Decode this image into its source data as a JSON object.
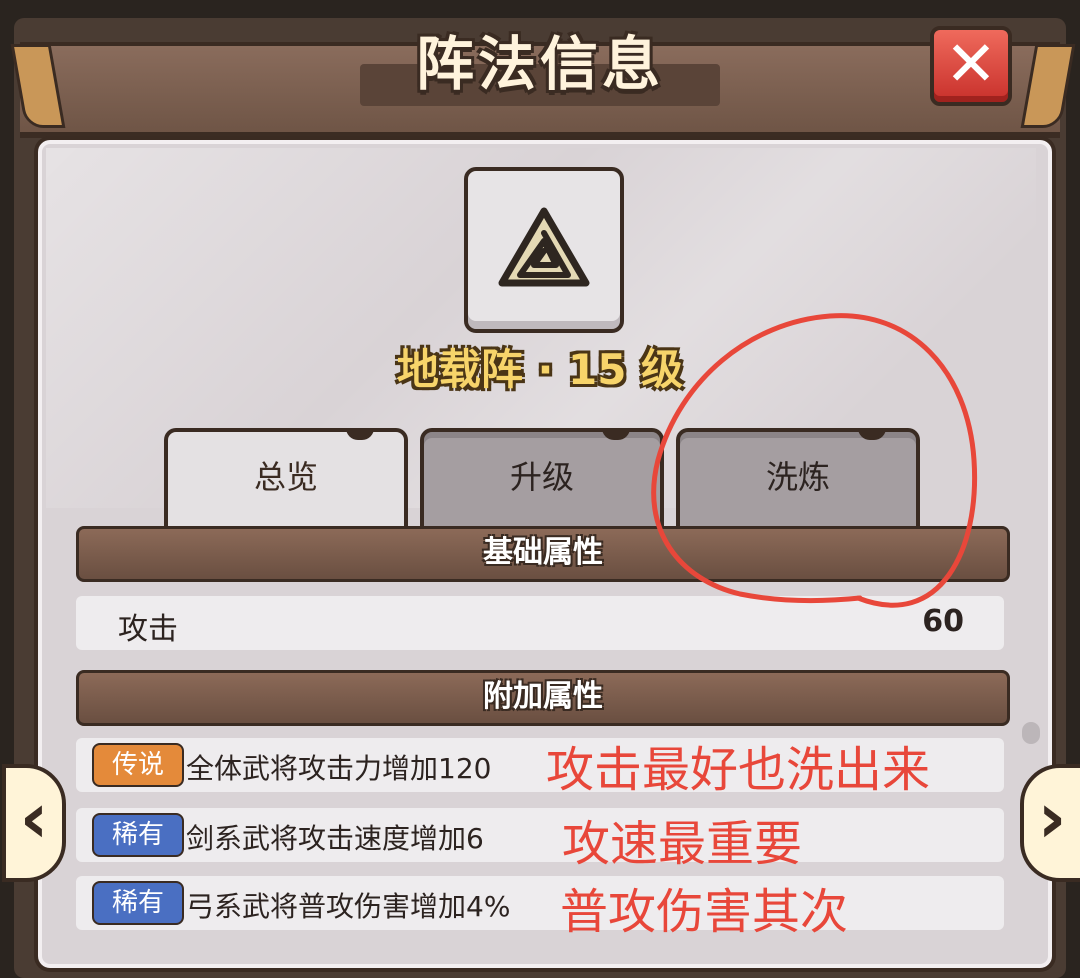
{
  "header": {
    "title": "阵法信息",
    "close_label": "✕"
  },
  "formation": {
    "icon": "triangle-spiral-icon",
    "name_level": "地载阵 · 15 级"
  },
  "tabs": [
    {
      "label": "总览",
      "active": true
    },
    {
      "label": "升级",
      "active": false
    },
    {
      "label": "洗炼",
      "active": false
    }
  ],
  "base_attributes": {
    "title": "基础属性",
    "rows": [
      {
        "label": "攻击",
        "value": "60"
      }
    ]
  },
  "extra_attributes": {
    "title": "附加属性",
    "rows": [
      {
        "rarity": "传说",
        "text": "全体武将攻击力增加120"
      },
      {
        "rarity": "稀有",
        "text": "剑系武将攻击速度增加6"
      },
      {
        "rarity": "稀有",
        "text": "弓系武将普攻伤害增加4%"
      }
    ]
  },
  "annotations": {
    "note1": "攻击最好也洗出来",
    "note2": "攻速最重要",
    "note3": "普攻伤害其次",
    "color": "#e8473a"
  },
  "nav": {
    "prev": "‹",
    "next": "›"
  },
  "colors": {
    "legend_badge": "#e48a3a",
    "rare_badge": "#4a6fc2",
    "title_gold": "#f7d46a"
  }
}
